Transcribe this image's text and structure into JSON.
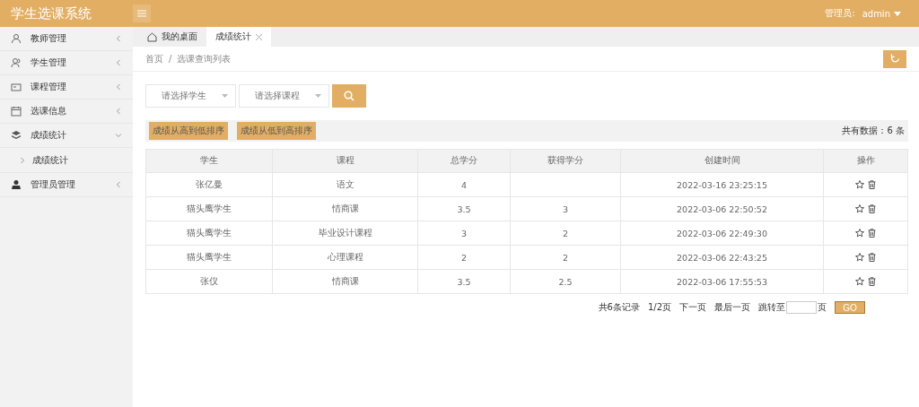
{
  "header": {
    "title": "学生选课系统",
    "user_label": "管理员:",
    "user_name": "admin"
  },
  "sidebar": {
    "items": [
      {
        "label": "教师管理",
        "expanded": false
      },
      {
        "label": "学生管理",
        "expanded": false
      },
      {
        "label": "课程管理",
        "expanded": false
      },
      {
        "label": "选课信息",
        "expanded": false
      },
      {
        "label": "成绩统计",
        "expanded": true,
        "children": [
          {
            "label": "成绩统计"
          }
        ]
      },
      {
        "label": "管理员管理",
        "expanded": false
      }
    ]
  },
  "tabs": [
    {
      "label": "我的桌面",
      "selected": false
    },
    {
      "label": "成绩统计",
      "selected": true
    }
  ],
  "breadcrumb": {
    "separator": "/",
    "items": [
      "首页",
      "选课查询列表"
    ]
  },
  "filters": [
    {
      "placeholder": "请选择学生"
    },
    {
      "placeholder": "请选择课程"
    }
  ],
  "sort_buttons": [
    "成绩从高到低排序",
    "成绩从低到高排序"
  ],
  "total": "共有数据：6 条",
  "table": {
    "columns": [
      "学生",
      "课程",
      "总学分",
      "获得学分",
      "创建时间",
      "操作"
    ],
    "rows": [
      {
        "student": "张亿曼",
        "course": "语文",
        "total": "4",
        "time": "2022-03-16 23:25:15"
      },
      {
        "student": "猫头鹰学生",
        "course": "情商课",
        "total": "3.5",
        "earned": "3",
        "time": "2022-03-06 22:50:52"
      },
      {
        "student": "猫头鹰学生",
        "course": "毕业设计课程",
        "total": "3",
        "earned": "2",
        "time": "2022-03-06 22:49:30"
      },
      {
        "student": "猫头鹰学生",
        "course": "心理课程",
        "total": "2",
        "earned": "2",
        "time": "2022-03-06 22:43:25"
      },
      {
        "student": "张仪",
        "course": "情商课",
        "total": "3.5",
        "earned": "2.5",
        "time": "2022-03-06 17:55:53"
      }
    ]
  },
  "pagination": {
    "records": "共6条记录",
    "page": "1/2页",
    "next": "下一页",
    "last": "最后一页",
    "jump": "跳转至",
    "unit": "页",
    "go": "GO"
  }
}
